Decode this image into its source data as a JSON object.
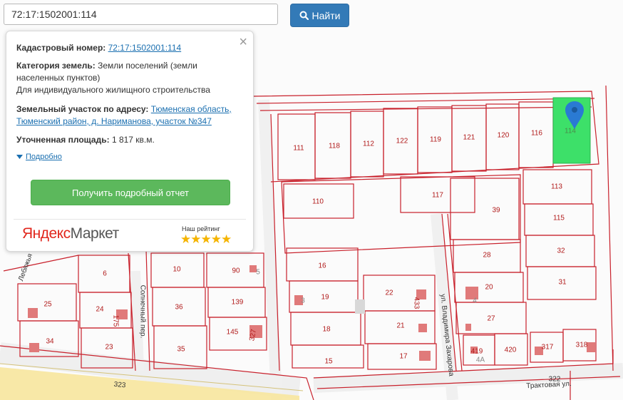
{
  "search": {
    "value": "72:17:1502001:114",
    "button_label": "Найти"
  },
  "popup": {
    "cadastral_label": "Кадастровый номер:",
    "cadastral_value": "72:17:1502001:114",
    "category_label": "Категория земель:",
    "category_value_line1": "Земли поселений (земли",
    "category_value_line2": "населенных пунктов)",
    "usage": "Для индивидуального жилищного строительства",
    "address_label": "Земельный участок по адресу:",
    "address_line1": "Тюменская область,",
    "address_line2": "Тюменский район, д. Нариманова, участок №347",
    "area_label": "Уточненная площадь:",
    "area_value": "1 817 кв.м.",
    "more_link": "Подробно",
    "report_button": "Получить подробный отчет",
    "ad_brand_ya": "Яндекс",
    "ad_brand_market": "Маркет",
    "ad_rating_label": "Наш рейтинг",
    "ad_stars": "★★★★★"
  },
  "colors": {
    "parcel_border": "#c8202b",
    "selected_parcel": "#3de069",
    "marker": "#2a7ad3",
    "building": "#e07a7a",
    "road_yellow": "#f7e59d"
  },
  "map": {
    "parcel_labels": [
      "111",
      "118",
      "112",
      "122",
      "119",
      "121",
      "120",
      "116",
      "114",
      "110",
      "117",
      "39",
      "113",
      "115",
      "32",
      "28",
      "31",
      "16",
      "19",
      "22",
      "433",
      "20",
      "4",
      "27",
      "18",
      "21",
      "15",
      "17",
      "419",
      "420",
      "4А",
      "317",
      "318",
      "6",
      "24",
      "175",
      "23",
      "25",
      "34",
      "10",
      "36",
      "35",
      "90",
      "5",
      "139",
      "145",
      "327",
      "3"
    ],
    "street_labels": [
      "Солнечный пер.",
      "ул. Владимира Захарова",
      "Лебяжья",
      "Трактовая ул.",
      "323",
      "322"
    ]
  }
}
